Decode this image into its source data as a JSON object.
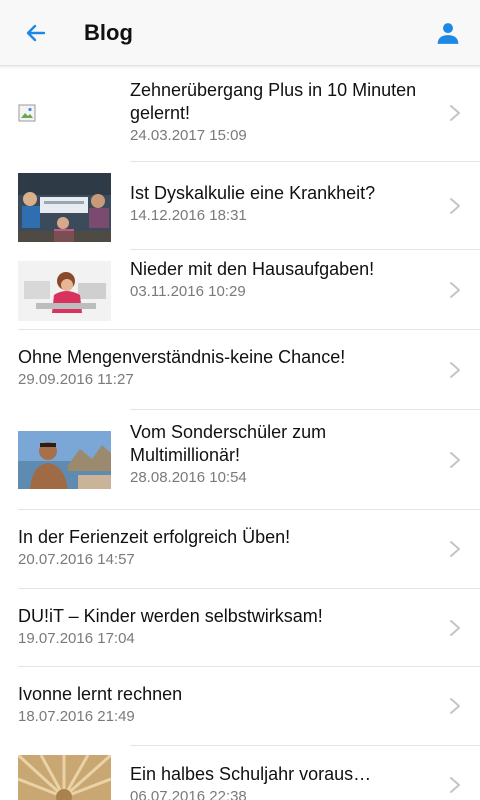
{
  "header": {
    "title": "Blog"
  },
  "posts": [
    {
      "title": "Zehnerübergang Plus in 10 Minuten gelernt!",
      "date": "24.03.2017 15:09"
    },
    {
      "title": "Ist Dyskalkulie eine Krankheit?",
      "date": "14.12.2016 18:31"
    },
    {
      "title": "Nieder mit den Hausaufgaben!",
      "date": "03.11.2016 10:29"
    },
    {
      "title": "Ohne Mengenverständnis-keine Chance!",
      "date": "29.09.2016 11:27"
    },
    {
      "title": "Vom Sonderschüler zum Multimillionär!",
      "date": "28.08.2016 10:54"
    },
    {
      "title": "In der Ferienzeit erfolgreich Üben!",
      "date": "20.07.2016 14:57"
    },
    {
      "title": "DU!iT – Kinder werden selbstwirksam!",
      "date": "19.07.2016 17:04"
    },
    {
      "title": "Ivonne lernt rechnen",
      "date": "18.07.2016 21:49"
    },
    {
      "title": "Ein halbes Schuljahr voraus…",
      "date": "06.07.2016 22:38"
    }
  ],
  "colors": {
    "accent": "#1e88e5",
    "chevron": "#c4c4c4",
    "date_text": "#7a7a7a",
    "separator": "#e4e4e4"
  },
  "icons": {
    "back": "arrow-left-icon",
    "profile": "person-icon",
    "row": "chevron-right-icon"
  }
}
